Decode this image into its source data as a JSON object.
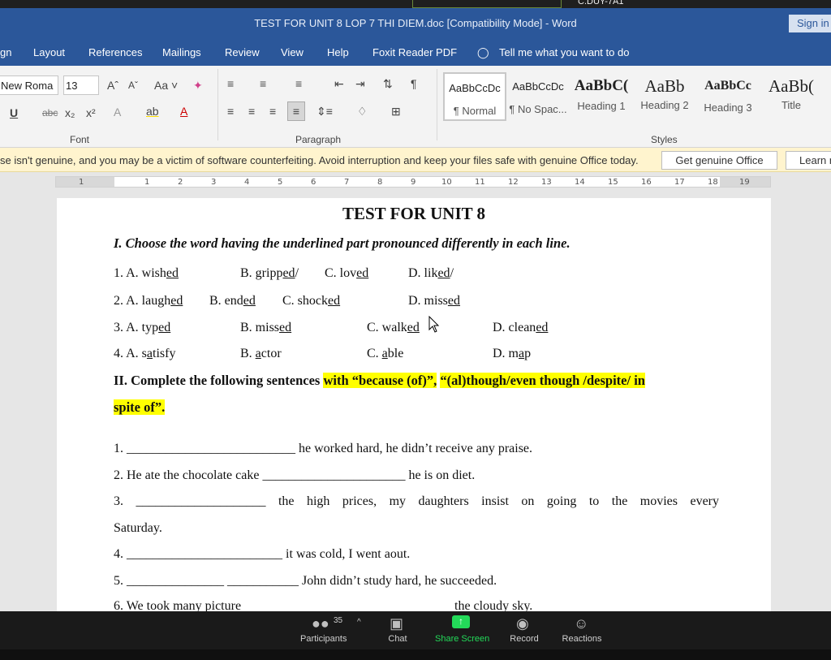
{
  "app": {
    "title": "TEST FOR UNIT 8 LOP 7 THI DIEM.doc [Compatibility Mode]  -  Word",
    "signin": "Sign in",
    "top_label": "C.DUY-7A1"
  },
  "tabs": [
    "gn",
    "Layout",
    "References",
    "Mailings",
    "Review",
    "View",
    "Help",
    "Foxit Reader PDF",
    "Tell me what you want to do"
  ],
  "ribbon": {
    "font_name": "New Roma",
    "font_size": "13",
    "font_group": "Font",
    "paragraph_group": "Paragraph",
    "styles_group": "Styles",
    "styles": [
      {
        "preview": "AaBbCcDc",
        "name": "¶ Normal"
      },
      {
        "preview": "AaBbCcDc",
        "name": "¶ No Spac..."
      },
      {
        "preview": "AaBbC(",
        "name": "Heading 1"
      },
      {
        "preview": "AaBb",
        "name": "Heading 2"
      },
      {
        "preview": "AaBbCc",
        "name": "Heading 3"
      },
      {
        "preview": "AaBb(",
        "name": "Title"
      }
    ]
  },
  "notice": {
    "message": "se isn't genuine, and you may be a victim of software counterfeiting. Avoid interruption and keep your files safe with genuine Office today.",
    "button": "Get genuine Office",
    "learn": "Learn m"
  },
  "ruler": [
    "1",
    "1",
    "2",
    "3",
    "4",
    "5",
    "6",
    "7",
    "8",
    "9",
    "10",
    "11",
    "12",
    "13",
    "14",
    "15",
    "16",
    "17",
    "18",
    "19"
  ],
  "document": {
    "heading": "TEST FOR UNIT 8",
    "section1": "I. Choose the word having the underlined part pronounced differently in each line.",
    "q1": {
      "n": "1. A. wish",
      "a_u": "ed",
      "b": "B. gripp",
      "b_u": "ed",
      "b_tail": "/",
      "c": "C. lov",
      "c_u": "ed",
      "d": "D. lik",
      "d_u": "ed",
      "d_tail": "/"
    },
    "q2": {
      "n": "2. A. laugh",
      "a_u": "ed",
      "b": "B. end",
      "b_u": "ed",
      "c": "C.  shock",
      "c_u": "ed",
      "d": "D. miss",
      "d_u": "ed"
    },
    "q3": {
      "n": "3. A. typ",
      "a_u": "ed",
      "b": "B. miss",
      "b_u": "ed",
      "c": "C. walk",
      "c_u": "ed",
      "d": "D. clean",
      "d_u": "ed"
    },
    "q4": {
      "n": "4. A. s",
      "a_u": "a",
      "a_tail": "tisfy",
      "b": "B. ",
      "b_u": "a",
      "b_tail": "ctor",
      "c": "C. ",
      "c_u": "a",
      "c_tail": "ble",
      "d": "D. m",
      "d_u": "a",
      "d_tail": "p"
    },
    "section2_a": "II. Complete the following sentences ",
    "section2_hl1": "with “because (of)”,",
    "section2_hl2": "“(al)though/even though /despite/ in",
    "section2_hl3": "spite of”.",
    "s1": "1. __________________________ he worked hard, he didn’t receive any praise.",
    "s2": "2. He ate the chocolate cake ______________________ he is on diet.",
    "s3": "3. ____________________ the high prices, my daughters insist on going to the movies every",
    "s3b": "Saturday.",
    "s4": "4. ________________________ it was cold, I went aout.",
    "s5": "5. _______________ ___________ John didn’t study hard, he succeeded.",
    "s6a": "6. We took many picture",
    "s6b": "the cloudy sky."
  },
  "taskbar": {
    "participants": "Participants",
    "participant_count": "35",
    "chat": "Chat",
    "share": "Share Screen",
    "record": "Record",
    "reactions": "Reactions"
  },
  "colors": {
    "word_blue": "#2b579a",
    "highlight": "#ffff00",
    "share_green": "#23d959",
    "notice_bg": "#fff4ce"
  }
}
